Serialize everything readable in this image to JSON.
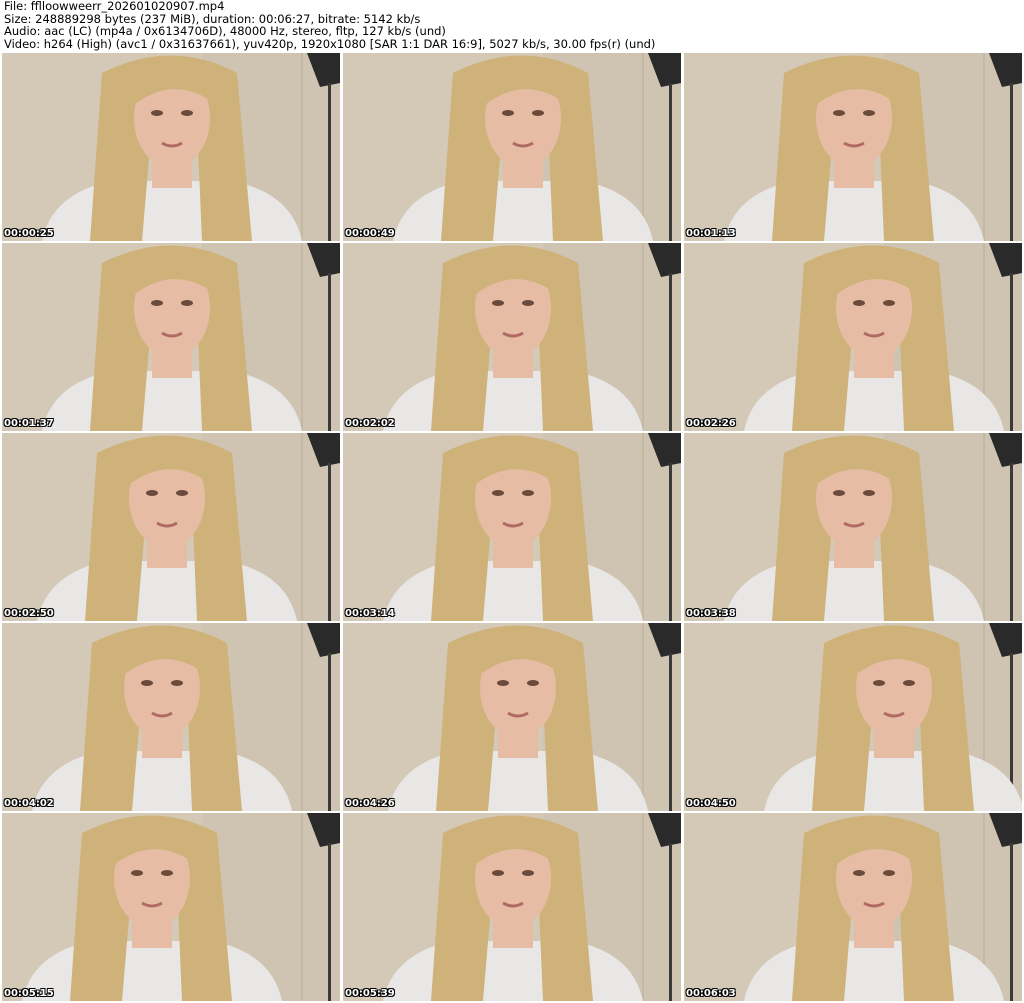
{
  "header": {
    "file": "File: fflloowweerr_202601020907.mp4",
    "size": "Size: 248889298 bytes (237 MiB), duration: 00:06:27, bitrate: 5142 kb/s",
    "audio": "Audio: aac (LC) (mp4a / 0x6134706D), 48000 Hz, stereo, fltp, 127 kb/s (und)",
    "video": "Video: h264 (High) (avc1 / 0x31637661), yuv420p, 1920x1080 [SAR 1:1 DAR 16:9], 5027 kb/s, 30.00 fps(r) (und)"
  },
  "thumbnails": [
    {
      "timestamp": "00:00:25"
    },
    {
      "timestamp": "00:00:49"
    },
    {
      "timestamp": "00:01:13"
    },
    {
      "timestamp": "00:01:37"
    },
    {
      "timestamp": "00:02:02"
    },
    {
      "timestamp": "00:02:26"
    },
    {
      "timestamp": "00:02:50"
    },
    {
      "timestamp": "00:03:14"
    },
    {
      "timestamp": "00:03:38"
    },
    {
      "timestamp": "00:04:02"
    },
    {
      "timestamp": "00:04:26"
    },
    {
      "timestamp": "00:04:50"
    },
    {
      "timestamp": "00:05:15"
    },
    {
      "timestamp": "00:05:39"
    },
    {
      "timestamp": "00:06:03"
    }
  ],
  "colors": {
    "wall": "#d3c9b6",
    "hair": "#cfb27a",
    "skin": "#e6bda4",
    "shirt": "#e8e7e6",
    "lamp": "#2a2a2a"
  }
}
